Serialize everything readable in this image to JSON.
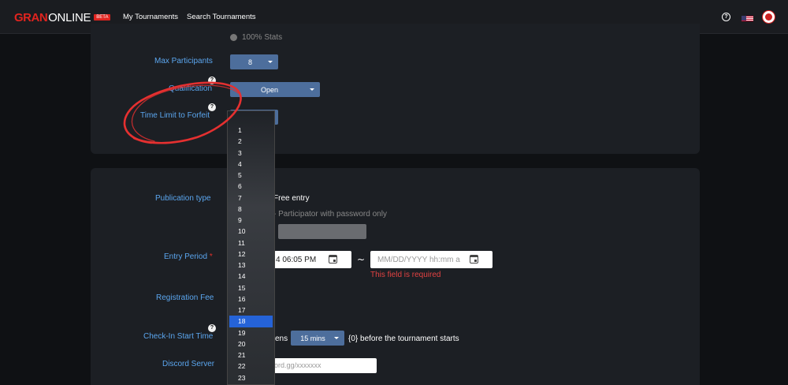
{
  "header": {
    "logo_gran": "GRAN",
    "logo_online": "ONLINE",
    "logo_beta": "BETA",
    "nav": [
      "My Tournaments",
      "Search Tournaments"
    ],
    "help": "?"
  },
  "settings_card": {
    "stats_option": "100% Stats",
    "max_participants_label": "Max Participants",
    "max_participants_value": "8",
    "qualification_label": "Qualification",
    "qualification_value": "Open",
    "time_limit_label": "Time Limit to Forfeit",
    "help_icon": "?"
  },
  "dropdown": {
    "options": [
      "1",
      "2",
      "3",
      "4",
      "5",
      "6",
      "7",
      "8",
      "9",
      "10",
      "11",
      "12",
      "13",
      "14",
      "15",
      "16",
      "17",
      "18",
      "19",
      "20",
      "21",
      "22",
      "23"
    ],
    "selected": "18"
  },
  "publication_card": {
    "publication_type_label": "Publication type",
    "free_entry": "Free entry",
    "password_option": "- Participator with password only",
    "entry_period_label": "Entry Period",
    "required_mark": "*",
    "entry_start_value": "4 06:05 PM",
    "tilde": "~",
    "entry_end_placeholder": "MM/DD/YYYY hh:mm a",
    "entry_end_error": "This field is required",
    "registration_fee_label": "Registration Fee",
    "checkin_label": "Check-In Start Time",
    "checkin_prefix": "ens",
    "checkin_value": "15 mins",
    "checkin_suffix": "{0} before the tournament starts",
    "discord_label": "Discord Server",
    "discord_placeholder": "ord.gg/xxxxxxx"
  },
  "colors": {
    "accent_label": "#5ba6ef",
    "select_bg": "#4d6e9c",
    "error": "#e34242",
    "brand_red": "#e0241f",
    "selected_option": "#2563d8"
  }
}
